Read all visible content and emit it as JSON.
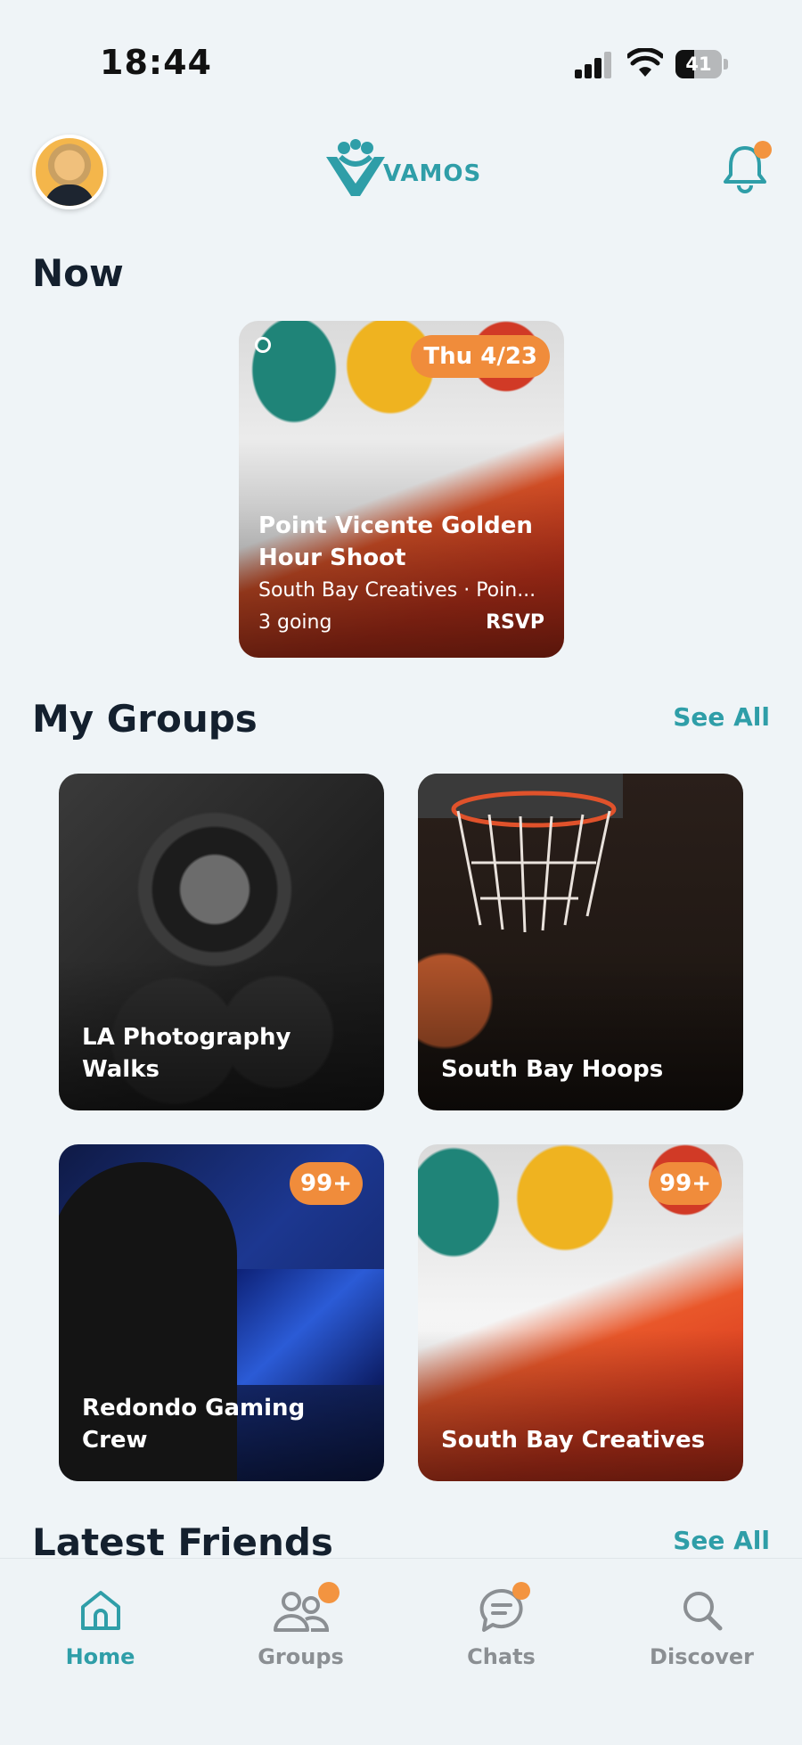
{
  "status_bar": {
    "time": "18:44",
    "battery": "41",
    "battery_level": 0.41
  },
  "header": {
    "logo_text": "VAMOS"
  },
  "now_section": {
    "title": "Now",
    "card": {
      "date": "Thu 4/23",
      "title": "Point Vicente Golden Hour Shoot",
      "subtitle": "South Bay Creatives · Poin...",
      "going": "3 going",
      "rsvp": "RSVP"
    }
  },
  "groups_section": {
    "title": "My Groups",
    "see_all": "See All",
    "groups": [
      {
        "name": "LA Photography Walks",
        "badge": ""
      },
      {
        "name": "South Bay Hoops",
        "badge": ""
      },
      {
        "name": "Redondo Gaming Crew",
        "badge": "99+"
      },
      {
        "name": "South Bay Creatives",
        "badge": "99+"
      }
    ]
  },
  "friends_section": {
    "title": "Latest Friends",
    "see_all": "See All"
  },
  "bottom_nav": {
    "items": [
      {
        "label": "Home",
        "icon": "home-icon",
        "active": true
      },
      {
        "label": "Groups",
        "icon": "groups-icon",
        "active": false
      },
      {
        "label": "Chats",
        "icon": "chat-icon",
        "active": false
      },
      {
        "label": "Discover",
        "icon": "search-icon",
        "active": false
      }
    ]
  },
  "colors": {
    "accent": "#2f9ea8",
    "badge": "#f08c3b",
    "background": "#eff4f7"
  }
}
